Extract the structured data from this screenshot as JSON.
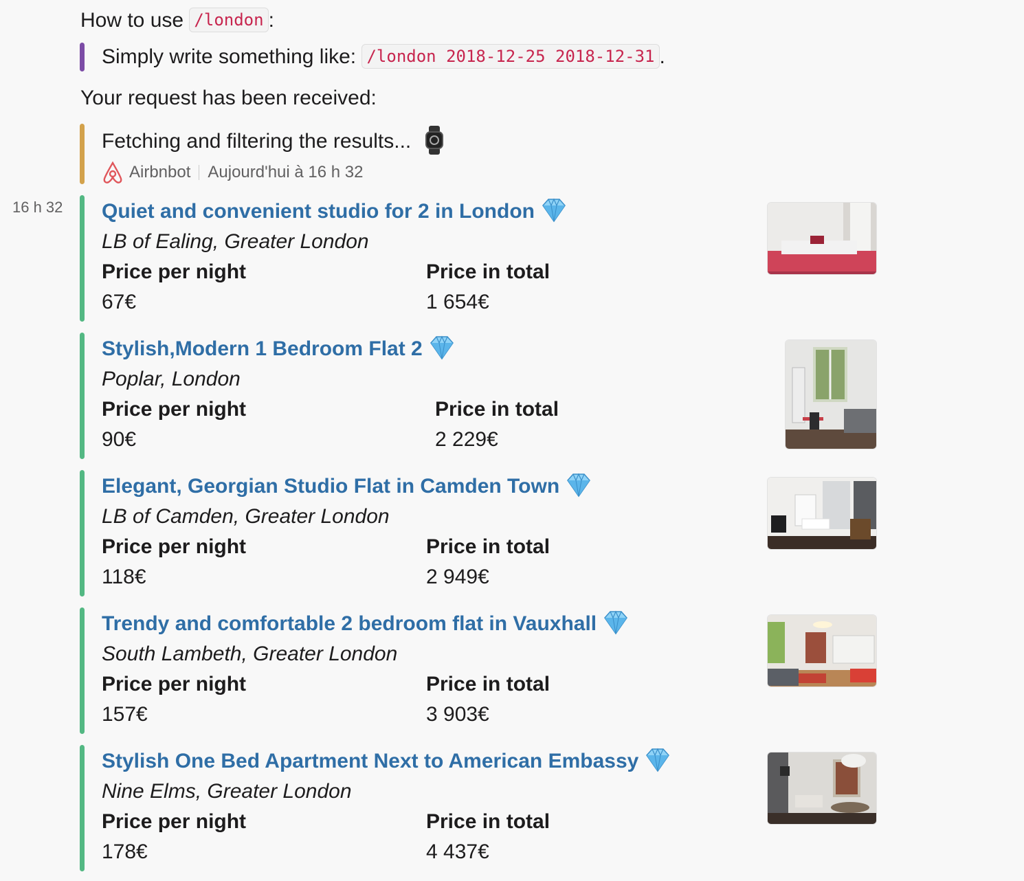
{
  "intro": {
    "how_to_prefix": "How to use",
    "command": "/london",
    "colon": ":",
    "simply_prefix": "Simply write something like:",
    "example_command": "/london 2018-12-25 2018-12-31",
    "period": ".",
    "received": "Your request has been received:",
    "fetching": "Fetching and filtering the results...",
    "watch_icon": "watch-emoji"
  },
  "bot": {
    "name": "Airbnbot",
    "timestamp": "Aujourd'hui à 16 h 32",
    "logo_icon": "airbnb-logo"
  },
  "message_time": "16 h 32",
  "colors": {
    "purple": "#7c4ca6",
    "gold": "#d3a24c",
    "green": "#53b883",
    "link": "#2f6ea6",
    "code": "#c7254e"
  },
  "listings": [
    {
      "title": "Quiet and convenient studio for 2 in London",
      "location": "LB of Ealing, Greater London",
      "night_label": "Price per night",
      "night_price": "67€",
      "total_label": "Price in total",
      "total_price": "1 654€",
      "icon": "gem-emoji"
    },
    {
      "title": "Stylish,Modern 1 Bedroom Flat 2",
      "location": "Poplar, London",
      "night_label": "Price per night",
      "night_price": "90€",
      "total_label": "Price in total",
      "total_price": "2 229€",
      "icon": "gem-emoji"
    },
    {
      "title": "Elegant, Georgian Studio Flat in Camden Town",
      "location": "LB of Camden, Greater London",
      "night_label": "Price per night",
      "night_price": "118€",
      "total_label": "Price in total",
      "total_price": "2 949€",
      "icon": "gem-emoji"
    },
    {
      "title": "Trendy and comfortable 2 bedroom flat in Vauxhall",
      "location": "South Lambeth, Greater London",
      "night_label": "Price per night",
      "night_price": "157€",
      "total_label": "Price in total",
      "total_price": "3 903€",
      "icon": "gem-emoji"
    },
    {
      "title": "Stylish One Bed Apartment Next to American Embassy",
      "location": "Nine Elms, Greater London",
      "night_label": "Price per night",
      "night_price": "178€",
      "total_label": "Price in total",
      "total_price": "4 437€",
      "icon": "gem-emoji"
    }
  ]
}
